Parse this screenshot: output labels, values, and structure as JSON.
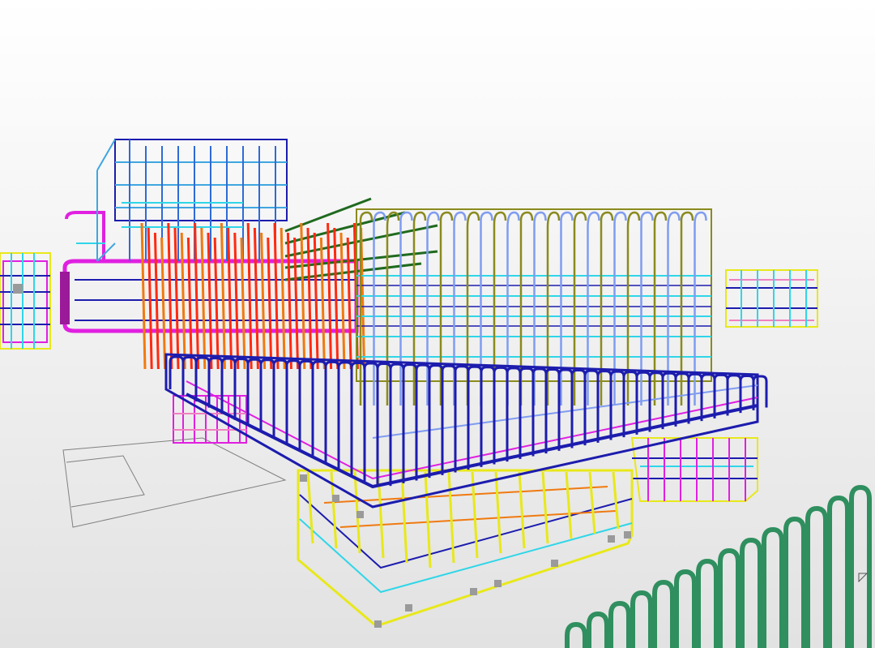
{
  "viewport": {
    "background_top": "#ffffff",
    "background_bottom": "#e2e2e2"
  },
  "rebar_colors": {
    "blue": "#1c1cae",
    "light_blue": "#7f9cf0",
    "cyan": "#2fd6e8",
    "sky": "#3fa6e0",
    "yellow": "#e8e81a",
    "olive": "#8a8a1e",
    "red": "#ff2a10",
    "orange": "#f07a10",
    "magenta": "#e020e0",
    "pink": "#f080c0",
    "dark_green": "#1f6a1f",
    "green": "#2f8f5f",
    "grey_outline": "#808080"
  }
}
